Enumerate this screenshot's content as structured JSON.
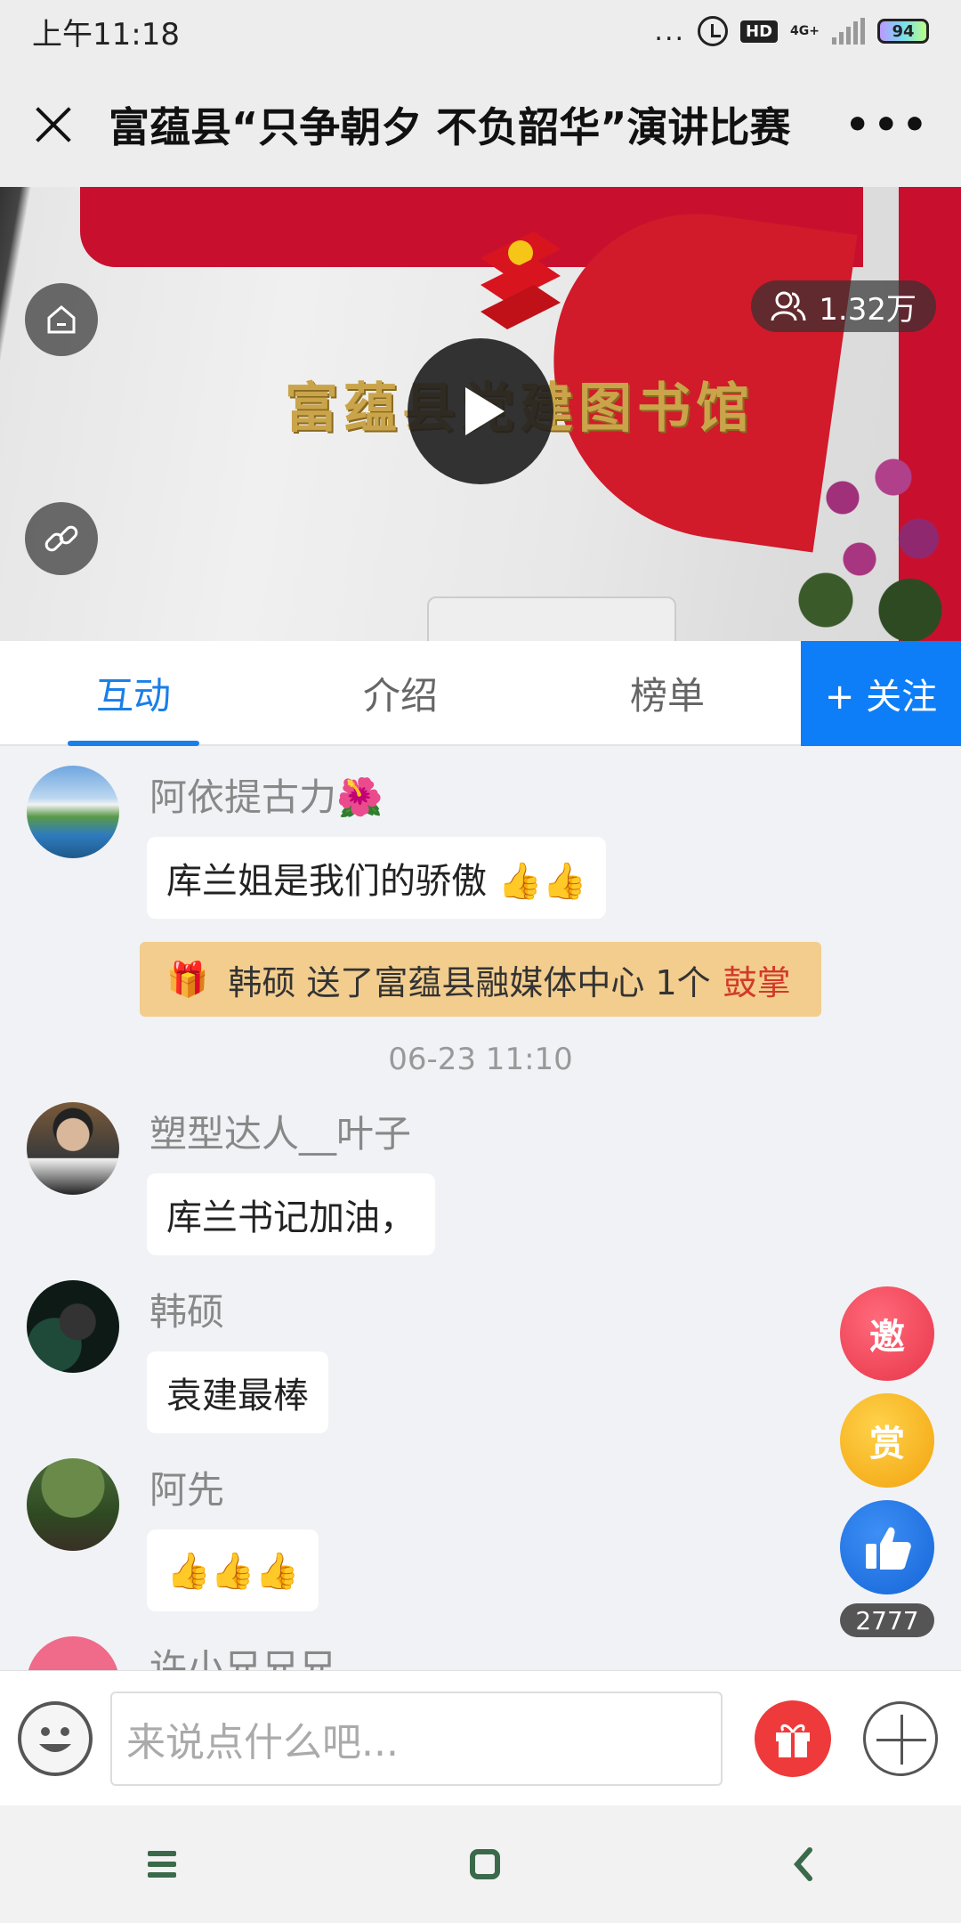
{
  "status_bar": {
    "time": "上午11:18",
    "dots": "...",
    "hd": "HD",
    "network": "4G+",
    "battery": "94"
  },
  "header": {
    "title": "富蕴县“只争朝夕 不负韶华”演讲比赛",
    "more": "•••"
  },
  "video": {
    "viewers": "1.32万",
    "wall_text": "富蕴县党建图书馆"
  },
  "tabs": [
    {
      "label": "互动",
      "active": true
    },
    {
      "label": "介绍",
      "active": false
    },
    {
      "label": "榜单",
      "active": false
    }
  ],
  "follow": {
    "label": "+ 关注"
  },
  "messages": [
    {
      "user": "阿依提古力🌺",
      "text": "库兰姐是我们的骄傲 👍👍"
    },
    {
      "user": "塑型达人__叶子",
      "text": "库兰书记加油，"
    },
    {
      "user": "韩硕",
      "text": "袁建最棒"
    },
    {
      "user": "阿先",
      "text": "👍👍👍"
    },
    {
      "user": "许小兄兄兄",
      "text": ""
    }
  ],
  "gift_notice": {
    "icon": "🎁",
    "text": "韩硕 送了富蕴县融媒体中心 1个",
    "gift_name": "鼓掌"
  },
  "timestamp": "06-23 11:10",
  "fab": {
    "invite": "邀",
    "reward": "赏",
    "like_count": "2777"
  },
  "input": {
    "placeholder": "来说点什么吧..."
  },
  "colors": {
    "accent": "#1a7fe8",
    "follow_bg": "#0d7ef7",
    "gift_notice_bg": "#f2cd8e",
    "gift_name": "#d23a2a"
  }
}
